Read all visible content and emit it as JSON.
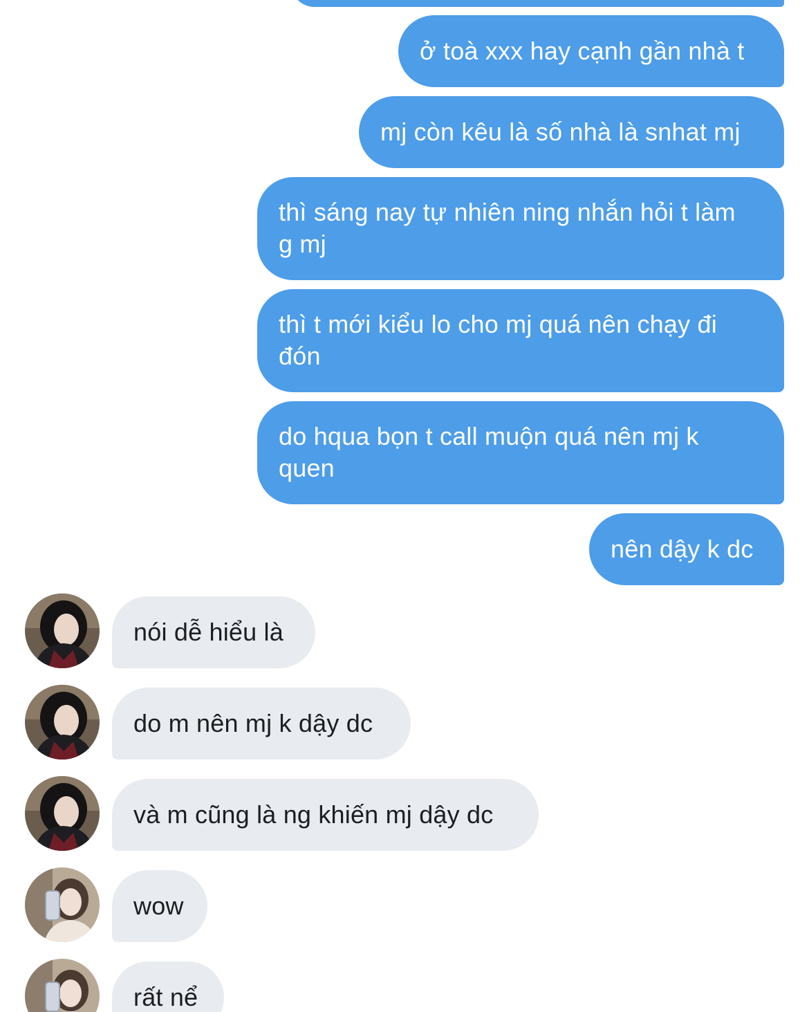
{
  "colors": {
    "outgoing_bubble": "#4d9de9",
    "incoming_bubble": "#e8ebef",
    "incoming_text": "#1c1e21",
    "background": "#ffffff"
  },
  "messages": [
    {
      "direction": "outgoing",
      "text": "ở toà xxx hay cạnh gần nhà t"
    },
    {
      "direction": "outgoing",
      "text": "mj còn kêu là số nhà là snhat mj"
    },
    {
      "direction": "outgoing",
      "text": "thì sáng nay tự nhiên ning nhắn hỏi t làm g mj"
    },
    {
      "direction": "outgoing",
      "text": "thì t mới kiểu lo cho mj quá nên chạy đi đón"
    },
    {
      "direction": "outgoing",
      "text": "do hqua bọn t call muộn quá nên mj k quen"
    },
    {
      "direction": "outgoing",
      "text": "nên dậy k dc"
    },
    {
      "direction": "incoming",
      "avatar": "avatar-dark-hair-icon",
      "text": "nói dễ hiểu là"
    },
    {
      "direction": "incoming",
      "avatar": "avatar-dark-hair-icon",
      "text": "do m nên mj k dậy dc"
    },
    {
      "direction": "incoming",
      "avatar": "avatar-dark-hair-icon",
      "text": "và m cũng là ng khiến mj dậy dc"
    },
    {
      "direction": "incoming",
      "avatar": "avatar-mirror-selfie-icon",
      "text": "wow"
    },
    {
      "direction": "incoming",
      "avatar": "avatar-mirror-selfie-icon",
      "text": "rất nể"
    }
  ]
}
